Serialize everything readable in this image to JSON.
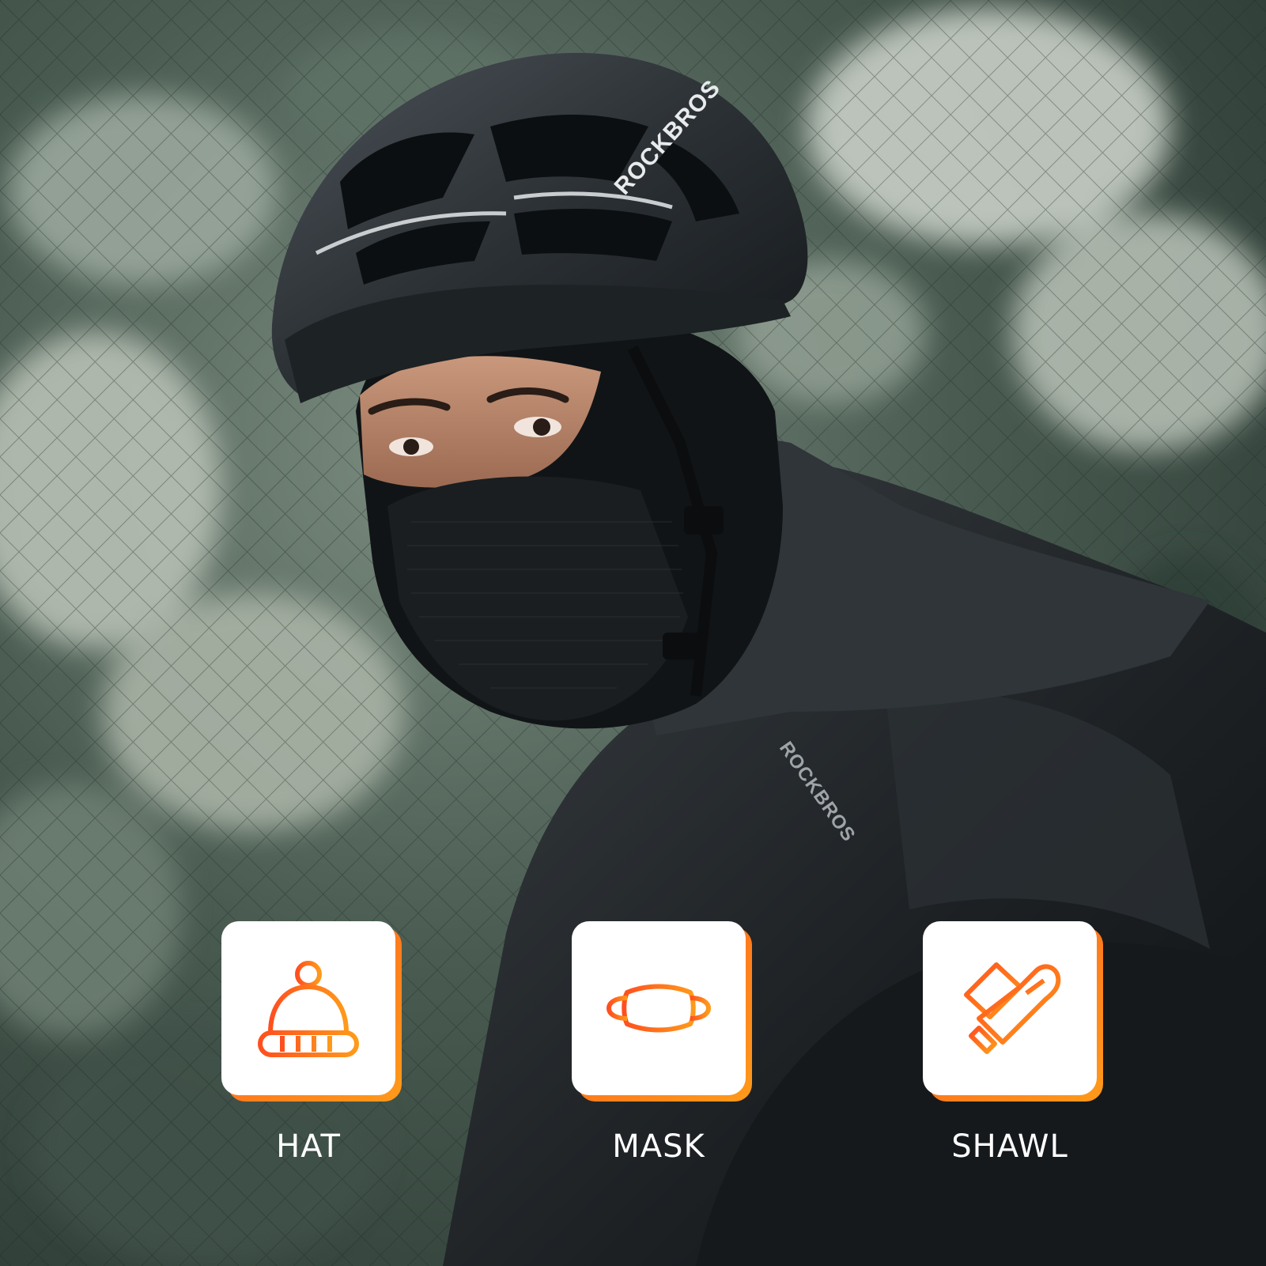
{
  "photo": {
    "helmet_brand": "ROCKBROS",
    "jacket_brand": "ROCKBROS"
  },
  "features": [
    {
      "label": "HAT",
      "icon": "beanie-hat-icon"
    },
    {
      "label": "MASK",
      "icon": "face-mask-icon"
    },
    {
      "label": "SHAWL",
      "icon": "scarf-shawl-icon"
    }
  ],
  "colors": {
    "accent_start": "#ff5a1f",
    "accent_end": "#ff9a1a",
    "card": "#ffffff",
    "label": "#ffffff"
  }
}
